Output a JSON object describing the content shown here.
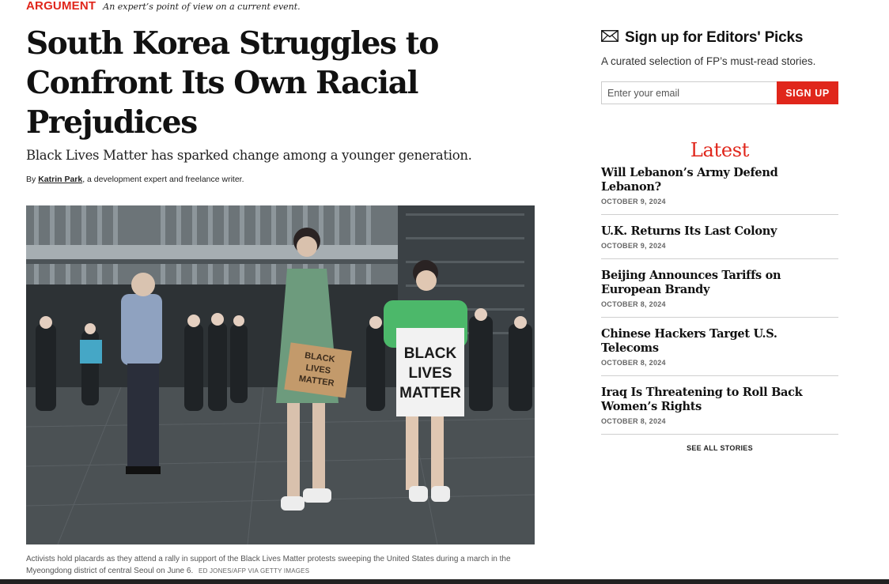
{
  "article": {
    "kicker": "ARGUMENT",
    "kicker_description": "An expert’s point of view on a current event.",
    "headline": "South Korea Struggles to Confront Its Own Racial Prejudices",
    "dek": "Black Lives Matter has sparked change among a younger generation.",
    "byline": {
      "prefix": "By",
      "author": "Katrin Park",
      "suffix": ", a development expert and freelance writer."
    },
    "photo": {
      "placard_left": [
        "BLACK",
        "LIVES",
        "MATTER"
      ],
      "placard_right": [
        "BLACK",
        "LIVES",
        "MATTER"
      ]
    },
    "caption": "Activists hold placards as they attend a rally in support of the Black Lives Matter protests sweeping the United States during a march in the Myeongdong district of central Seoul on June 6.",
    "credit": "ED JONES/AFP VIA GETTY IMAGES"
  },
  "newsletter": {
    "title": "Sign up for Editors' Picks",
    "description": "A curated selection of FP’s must-read stories.",
    "email_placeholder": "Enter your email",
    "email_value": "",
    "button_label": "SIGN UP",
    "icon": "envelope-icon"
  },
  "latest": {
    "heading": "Latest",
    "stories": [
      {
        "title": "Will Lebanon’s Army Defend Lebanon?",
        "date": "OCTOBER 9, 2024"
      },
      {
        "title": "U.K. Returns Its Last Colony",
        "date": "OCTOBER 9, 2024"
      },
      {
        "title": "Beijing Announces Tariffs on European Brandy",
        "date": "OCTOBER 8, 2024"
      },
      {
        "title": "Chinese Hackers Target U.S. Telecoms",
        "date": "OCTOBER 8, 2024"
      },
      {
        "title": "Iraq Is Threatening to Roll Back Women’s Rights",
        "date": "OCTOBER 8, 2024"
      }
    ],
    "see_all_label": "SEE ALL STORIES"
  },
  "colors": {
    "accent_red": "#e0261b",
    "text_dark": "#111111",
    "divider": "#cfcfcf"
  }
}
